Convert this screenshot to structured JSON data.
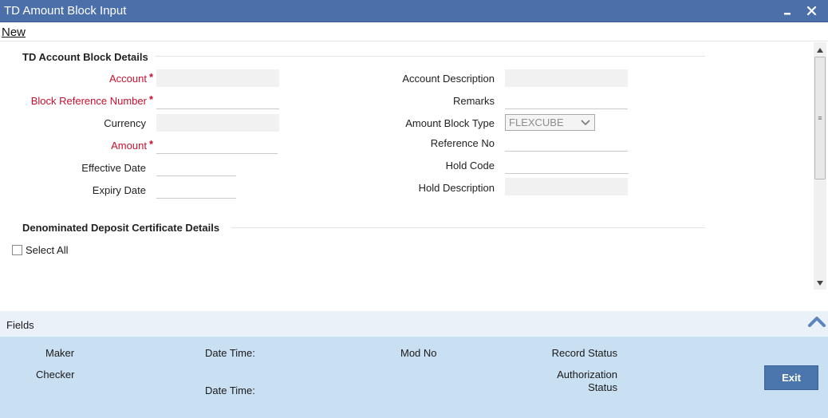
{
  "window": {
    "title": "TD Amount Block Input",
    "minimize_label": "▁",
    "close_label": "✕"
  },
  "menu": {
    "new_label": "New"
  },
  "block_details": {
    "title": "TD Account Block Details",
    "account_label": "Account",
    "block_ref_label": "Block Reference Number",
    "currency_label": "Currency",
    "amount_label": "Amount",
    "effective_date_label": "Effective Date",
    "expiry_date_label": "Expiry Date",
    "account_desc_label": "Account Description",
    "remarks_label": "Remarks",
    "amount_block_type_label": "Amount Block Type",
    "amount_block_type_value": "FLEXCUBE",
    "reference_no_label": "Reference No",
    "hold_code_label": "Hold Code",
    "hold_desc_label": "Hold Description",
    "required_mark": "*",
    "values": {
      "account": "",
      "block_ref": "",
      "currency": "",
      "amount": "",
      "effective_date": "",
      "expiry_date": "",
      "account_desc": "",
      "remarks": "",
      "reference_no": "",
      "hold_code": "",
      "hold_desc": ""
    }
  },
  "certificate_details": {
    "title": "Denominated Deposit Certificate Details",
    "select_all_label": "Select All",
    "select_all_checked": false
  },
  "footer": {
    "fields_label": "Fields",
    "maker_label": "Maker",
    "checker_label": "Checker",
    "date_time_label": "Date Time:",
    "mod_no_label": "Mod No",
    "record_status_label": "Record Status",
    "authorization_label": "Authorization",
    "status_label": "Status",
    "exit_label": "Exit"
  },
  "colors": {
    "title_bar": "#4b6fa8",
    "required_label": "#c8102e",
    "audit_panel": "#c9dff2",
    "exit_button": "#4b76ad"
  }
}
